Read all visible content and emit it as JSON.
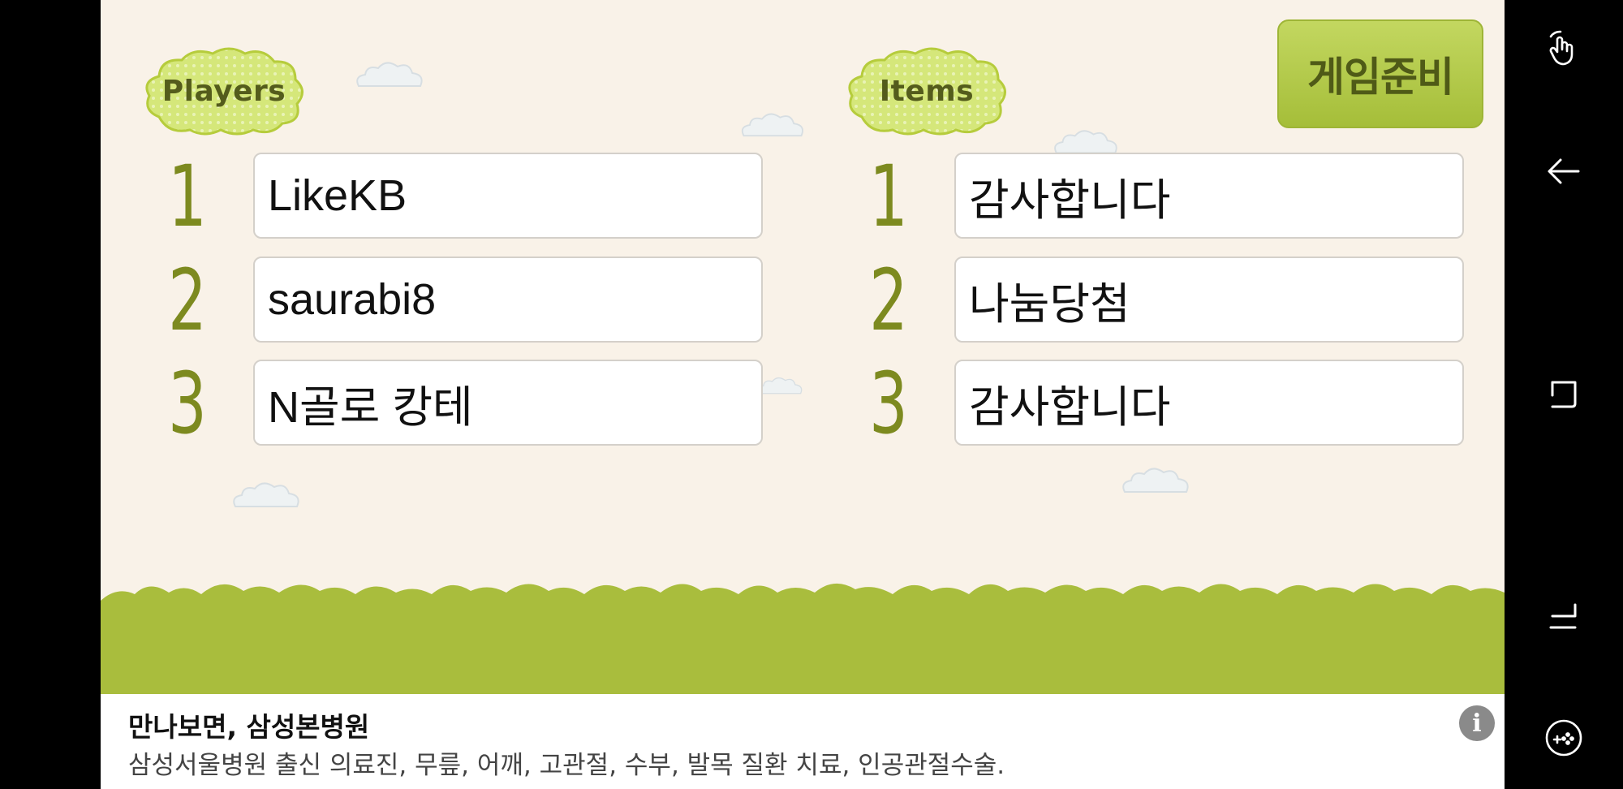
{
  "players_label": "Players",
  "items_label": "Items",
  "ready_button_label": "게임준비",
  "players": [
    {
      "number": "1",
      "name": "LikeKB"
    },
    {
      "number": "2",
      "name": "saurabi8"
    },
    {
      "number": "3",
      "name": "N골로 캉테"
    }
  ],
  "items": [
    {
      "number": "1",
      "name": "감사합니다"
    },
    {
      "number": "2",
      "name": "나눔당첨"
    },
    {
      "number": "3",
      "name": "감사합니다"
    }
  ],
  "ad": {
    "title": "만나보면, 삼성본병원",
    "description": "삼성서울병원 출신 의료진, 무릎, 어깨, 고관절, 수부, 발목 질환 치료, 인공관절수술.",
    "info_icon": "i"
  },
  "colors": {
    "background": "#f9f2e8",
    "accent_green": "#a9bd3d",
    "number_green": "#7d8a1f"
  },
  "nav_icons": [
    "touch-gesture-icon",
    "back-icon",
    "recent-apps-icon",
    "home-icon",
    "game-tools-icon"
  ]
}
